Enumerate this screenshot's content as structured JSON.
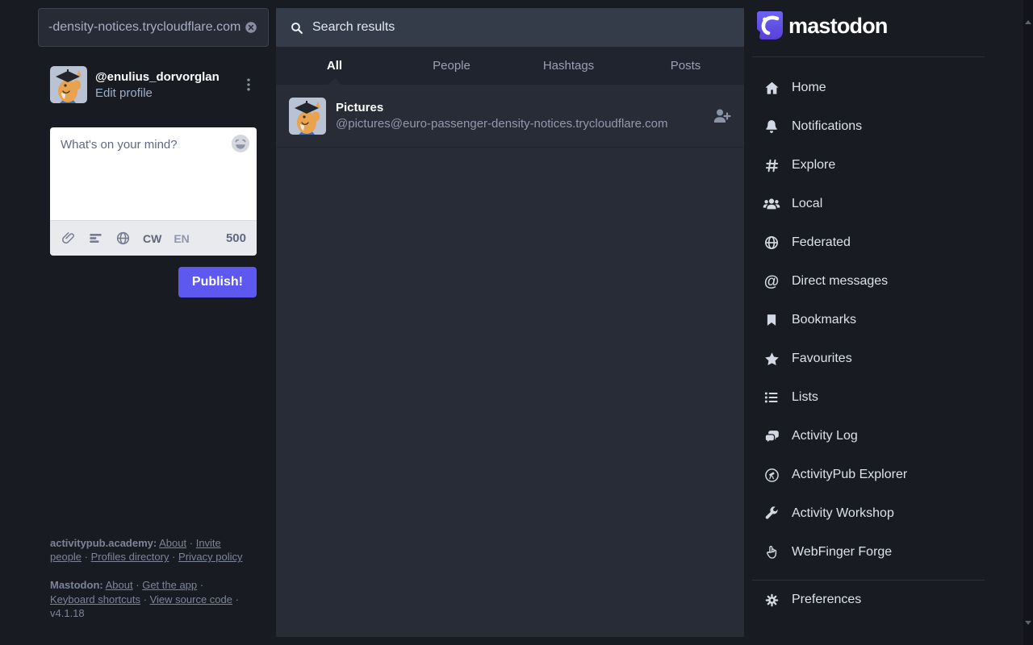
{
  "colors": {
    "accent": "#5c58f0",
    "page_bg": "#191b22",
    "panel_bg": "#282c37",
    "brand_purple": "#6364ff"
  },
  "drawer": {
    "search_value": "-density-notices.trycloudflare.com",
    "account": {
      "handle": "@enulius_dorvorglan",
      "edit_link": "Edit profile"
    },
    "compose": {
      "placeholder": "What's on your mind?",
      "cw": "CW",
      "lang": "EN",
      "char_count": "500",
      "publish": "Publish!"
    },
    "footer": {
      "sep": "·",
      "line1_site": "activitypub.academy:",
      "line1_links": [
        "About",
        "Invite people",
        "Profiles directory",
        "Privacy policy"
      ],
      "line2_site": "Mastodon:",
      "line2_links": [
        "About",
        "Get the app",
        "Keyboard shortcuts",
        "View source code"
      ],
      "version": "v4.1.18"
    }
  },
  "search_column": {
    "header": "Search results",
    "tabs": [
      {
        "label": "All"
      },
      {
        "label": "People"
      },
      {
        "label": "Hashtags"
      },
      {
        "label": "Posts"
      }
    ],
    "result": {
      "display_name": "Pictures",
      "handle": "@pictures@euro-passenger-density-notices.trycloudflare.com"
    }
  },
  "nav": {
    "brand": "mastodon",
    "items": [
      {
        "label": "Home"
      },
      {
        "label": "Notifications"
      },
      {
        "label": "Explore"
      },
      {
        "label": "Local"
      },
      {
        "label": "Federated"
      },
      {
        "label": "Direct messages"
      },
      {
        "label": "Bookmarks"
      },
      {
        "label": "Favourites"
      },
      {
        "label": "Lists"
      },
      {
        "label": "Activity Log"
      },
      {
        "label": "ActivityPub Explorer"
      },
      {
        "label": "Activity Workshop"
      },
      {
        "label": "WebFinger Forge"
      }
    ],
    "preferences": "Preferences"
  }
}
